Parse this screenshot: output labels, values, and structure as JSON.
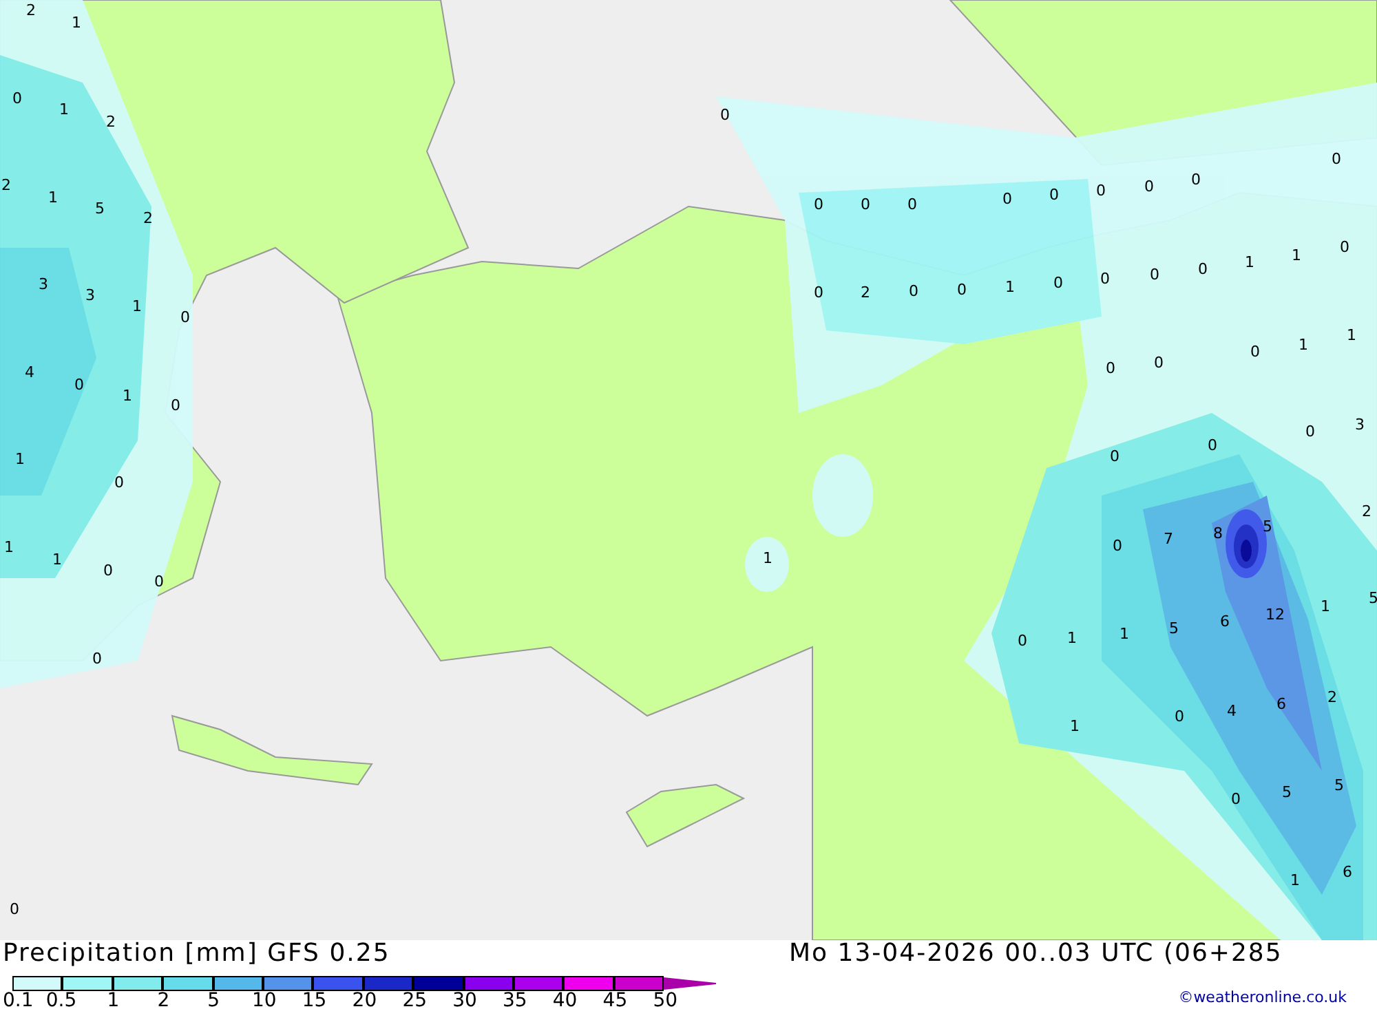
{
  "map": {
    "value_labels": [
      "2",
      "1",
      "0",
      "1",
      "2",
      "0",
      "2",
      "1",
      "5",
      "2",
      "0",
      "0",
      "0",
      "0",
      "0",
      "0",
      "0",
      "0",
      "0",
      "3",
      "3",
      "1",
      "0",
      "0",
      "2",
      "0",
      "0",
      "1",
      "0",
      "0",
      "0",
      "0",
      "1",
      "1",
      "0",
      "4",
      "0",
      "1",
      "0",
      "0",
      "0",
      "0",
      "1",
      "1",
      "1",
      "0",
      "0",
      "0",
      "0",
      "3",
      "1",
      "1",
      "0",
      "0",
      "1",
      "0",
      "7",
      "8",
      "5",
      "2",
      "0",
      "0",
      "1",
      "1",
      "5",
      "6",
      "12",
      "1",
      "5",
      "1",
      "0",
      "4",
      "6",
      "2",
      "0",
      "5",
      "5",
      "1",
      "6",
      "0"
    ]
  },
  "title": "Precipitation [mm] GFS 0.25",
  "datetime": "Mo 13-04-2026 00..03 UTC (06+285",
  "credit": "©weatheronline.co.uk",
  "legend": [
    {
      "label": "0.1",
      "color": "#d2fafa"
    },
    {
      "label": "0.5",
      "color": "#a0f5f5"
    },
    {
      "label": "1",
      "color": "#82ecec"
    },
    {
      "label": "2",
      "color": "#66dcea"
    },
    {
      "label": "5",
      "color": "#55b8ea"
    },
    {
      "label": "10",
      "color": "#5592ea"
    },
    {
      "label": "15",
      "color": "#3a52ee"
    },
    {
      "label": "20",
      "color": "#1a28c8"
    },
    {
      "label": "25",
      "color": "#000099"
    },
    {
      "label": "30",
      "color": "#8a00ee"
    },
    {
      "label": "35",
      "color": "#aa00ee"
    },
    {
      "label": "40",
      "color": "#ee00ee"
    },
    {
      "label": "45",
      "color": "#cc00cc"
    },
    {
      "label": "50",
      "color": "#aa00aa"
    }
  ]
}
